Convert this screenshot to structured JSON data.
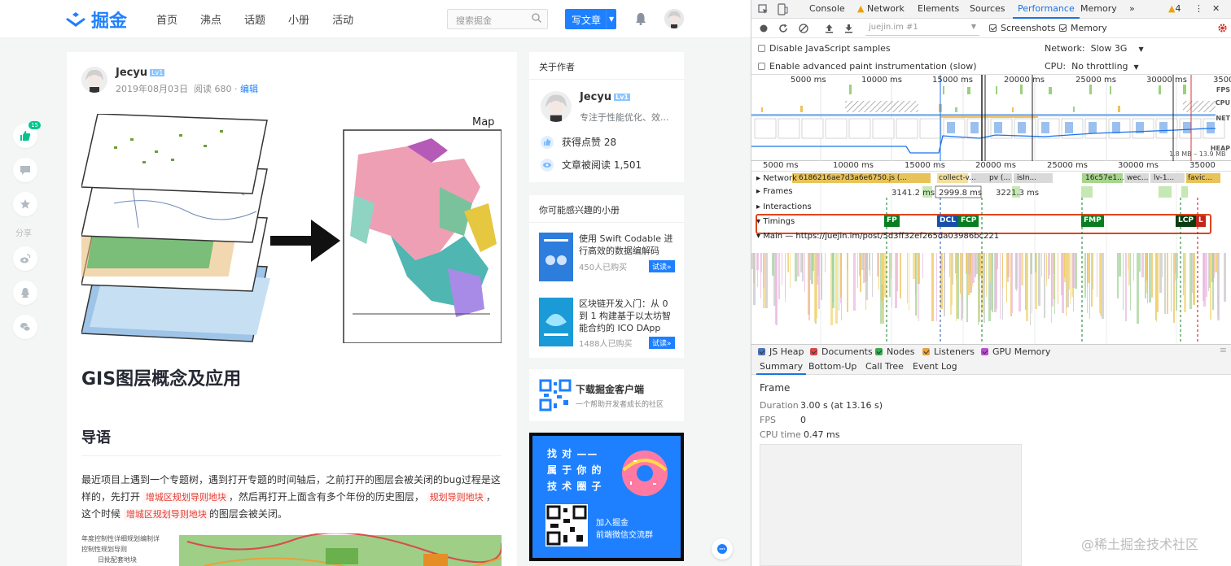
{
  "site": {
    "logo_text": "掘金",
    "nav": [
      "首页",
      "沸点",
      "话题",
      "小册",
      "活动"
    ],
    "search_placeholder": "搜索掘金",
    "write_button": "写文章",
    "side_like_count": "15",
    "share_label": "分享"
  },
  "article": {
    "author_name": "Jecyu",
    "author_level": "Lv1",
    "date": "2019年08月03日",
    "reads": "阅读 680",
    "edit": "编辑",
    "hero_label": "Map",
    "title": "GIS图层概念及应用",
    "section": "导语",
    "para_1": "最近项目上遇到一个专题树，遇到打开专题的时间轴后，之前打开的图层会被关闭的bug过程是这样的，先打开",
    "tag_1": "增城区规划导则地块",
    "para_2": "，然后再打开上面含有多个年份的历史图层，",
    "tag_2": "规划导则地块",
    "para_3": "，这个时候",
    "tag_3": "增城区规划导则地块",
    "para_4": "的图层会被关闭。",
    "tree_items": [
      "年度控制性详细规划编制详",
      "控制性规划导则",
      "日批配套地块"
    ]
  },
  "sidebar": {
    "about_title": "关于作者",
    "author_name": "Jecyu",
    "author_level": "Lv1",
    "author_bio": "专注于性能优化、效...",
    "likes": "获得点赞 28",
    "reads": "文章被阅读 1,501",
    "books_title": "你可能感兴趣的小册",
    "books": [
      {
        "title": "使用 Swift Codable 进行高效的数据编解码",
        "sold": "450人已购买",
        "action": "试读»"
      },
      {
        "title": "区块链开发入门：从 0 到 1 构建基于以太坊智能合约的 ICO DApp",
        "sold": "1488人已购买",
        "action": "试读»"
      }
    ],
    "app_title": "下载掘金客户端",
    "app_sub": "一个帮助开发者成长的社区",
    "ad_line1": "找 对 ——",
    "ad_line2": "属 于 你 的",
    "ad_line3": "技 术 圈 子",
    "ad_join": "加入掘金",
    "ad_group": "前端微信交流群"
  },
  "devtools": {
    "tabs": [
      "Console",
      "Network",
      "Elements",
      "Sources",
      "Performance",
      "Memory"
    ],
    "active_tab": "Performance",
    "warning_count": "4",
    "profile_select": "juejin.im #1",
    "screenshots_label": "Screenshots",
    "memory_label": "Memory",
    "disable_js_samples": "Disable JavaScript samples",
    "paint_instr": "Enable advanced paint instrumentation (slow)",
    "network_label": "Network:",
    "network_value": "Slow 3G",
    "cpu_label": "CPU:",
    "cpu_value": "No throttling",
    "overview_ticks": [
      "5000 ms",
      "10000 ms",
      "15000 ms",
      "20000 ms",
      "25000 ms",
      "30000 ms",
      "3500"
    ],
    "ruler_ticks": [
      "5000 ms",
      "10000 ms",
      "15000 ms",
      "20000 ms",
      "25000 ms",
      "30000 ms",
      "35000"
    ],
    "lanes": {
      "fps": "FPS",
      "cpu": "CPU",
      "net": "NET",
      "heap": "HEAP",
      "heap_range": "1.8 MB – 13.9 MB"
    },
    "tracks": {
      "network": "Network",
      "network_items": [
        "6186216ae7d3a6e6750.js (...",
        "collect-v...",
        "pv (...",
        "isIn...",
        "16c57e1...",
        "wec...",
        "lv-1...",
        "favic..."
      ],
      "frames": "Frames",
      "frame_times": [
        "3141.2 ms",
        "2999.8 ms",
        "3221.3 ms"
      ],
      "interactions": "Interactions",
      "timings": "Timings",
      "main": "Main — https://juejin.im/post/5d3ff32ef265da03986bc221"
    },
    "timing_markers": [
      "FP",
      "DCL",
      "FCP",
      "FMP",
      "LCP",
      "L"
    ],
    "legend": [
      "JS Heap",
      "Documents",
      "Nodes",
      "Listeners",
      "GPU Memory"
    ],
    "sub_tabs": [
      "Summary",
      "Bottom-Up",
      "Call Tree",
      "Event Log"
    ],
    "summary": {
      "heading": "Frame",
      "duration_label": "Duration",
      "duration_value": "3.00 s (at 13.16 s)",
      "fps_label": "FPS",
      "fps_value": "0",
      "cpu_label": "CPU time",
      "cpu_value": "0.47 ms"
    }
  },
  "watermark": "@稀土掘金技术社区"
}
